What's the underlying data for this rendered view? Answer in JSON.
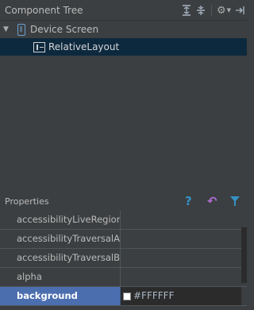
{
  "component_tree": {
    "title": "Component Tree",
    "header_icons": [
      "expand-all-icon",
      "collapse-all-icon",
      "gear-icon",
      "hide-icon"
    ],
    "items": [
      {
        "label": "Device Screen",
        "icon": "device-icon",
        "expanded": true
      },
      {
        "label": "RelativeLayout",
        "icon": "relative-layout-icon",
        "selected": true
      }
    ]
  },
  "properties": {
    "title": "Properties",
    "icons": [
      "help-icon",
      "undo-icon",
      "filter-icon"
    ],
    "rows": [
      {
        "name": "accessibilityLiveRegion",
        "value": ""
      },
      {
        "name": "accessibilityTraversalAfter",
        "value": ""
      },
      {
        "name": "accessibilityTraversalBefore",
        "value": ""
      },
      {
        "name": "alpha",
        "value": ""
      },
      {
        "name": "background",
        "value": "#FFFFFF",
        "selected": true,
        "swatch_color": "#FFFFFF"
      }
    ]
  },
  "colors": {
    "panel_bg": "#3c3f41",
    "selection": "#4b6eaf",
    "tree_selection": "#0d293e",
    "accent_blue": "#3592c4",
    "accent_purple": "#b16cd6"
  }
}
